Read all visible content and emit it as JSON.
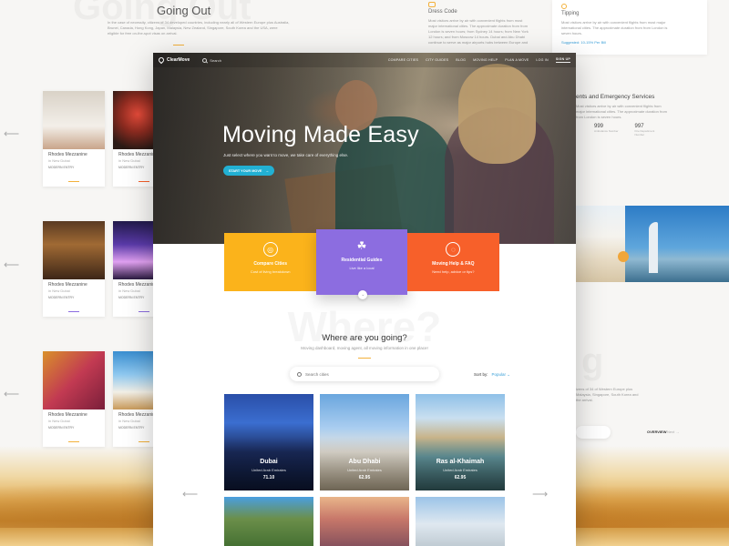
{
  "background": {
    "ghost_top": "Going Out",
    "header_title": "Going Out",
    "header_text": "In the case of necessity, citizens of 34 developed countries, including nearly all of Western Europe plus Australia, Brunei, Canada, Hong Kong, Japan, Malaysia, New Zealand, Singapore, South Korea and the USA, were eligible for free on-the-spot visas on arrival.",
    "dress_code": {
      "title": "Dress Code",
      "text": "Most visitors arrive by air with convenient flights from most major international cities. The approximate duration from from London is seven hours; from Sydney 14 hours; from New York 12 hours; and from Moscow 14 hours. Dubai and Abu Dhabi continue to serve as major airports hubs between Europe and"
    },
    "tipping": {
      "title": "Tipping",
      "text": "Most visitors arrive by air with convenient flights from most major international cities. The approximate duration from from London is seven hours.",
      "link": "Suggested: 10-15% Per Bill"
    },
    "emergency": {
      "title": "ents and Emergency Services",
      "text": "Most visitors arrive by air with convenient flights from major international cities. The approximate duration from from London is seven hours.",
      "stats": [
        {
          "value": "999",
          "label": "Ambulance Number"
        },
        {
          "value": "997",
          "label": "Fire Department Number"
        }
      ]
    },
    "right_text": "izens of 34 of Western Europe plus Malaysia, Singapore, South Korea and the arrival.",
    "overview_label": "OVERVIEW",
    "next_label": "Next",
    "ghost_right": "g",
    "mini_cards": [
      {
        "title": "Rhodes Mezzanine",
        "sub": "in New Dubai",
        "badge": "MODERN ENTRY"
      },
      {
        "title": "Rhodes Mezzanine",
        "sub": "in New Dubai",
        "badge": "MODERN ENTRY"
      },
      {
        "title": "Rhodes Mezzanine",
        "sub": "in New Dubai",
        "badge": "MODERN ENTRY"
      },
      {
        "title": "Rhodes Mezzanine",
        "sub": "in New Dubai",
        "badge": "MODERN ENTRY"
      },
      {
        "title": "Rhodes Mezzanine",
        "sub": "in New Dubai",
        "badge": "MODERN ENTRY"
      },
      {
        "title": "Rhodes Mezzanine",
        "sub": "in New Dubai",
        "badge": "MODERN ENTRY"
      }
    ]
  },
  "nav": {
    "brand": "ClearMove",
    "search_label": "Search",
    "links": [
      "Compare Cities",
      "City Guides",
      "Blog",
      "Moving Help",
      "Plan a Move",
      "Log In",
      "Sign Up"
    ]
  },
  "hero": {
    "title": "Moving Made Easy",
    "subtitle": "Just select where you want to move, we take care of everything else.",
    "cta": "Start Your Move"
  },
  "features": [
    {
      "title": "Compare Cities",
      "sub": "Cost of living breakdown",
      "color": "#fbb31b"
    },
    {
      "title": "Residential Guides",
      "sub": "Live like a local",
      "color": "#8c6de0"
    },
    {
      "title": "Moving Help & FAQ",
      "sub": "Need help, advice or tips?",
      "color": "#f7602a"
    }
  ],
  "where": {
    "ghost": "Where?",
    "title": "Where are you going?",
    "subtitle": "Moving dashboard, moving agent, all moving information in one place!",
    "search_placeholder": "Search cities",
    "sort_label": "Sort by:",
    "sort_value": "Popular"
  },
  "cities": [
    {
      "name": "Dubai",
      "country": "United Arab Emirates",
      "score": "71.10"
    },
    {
      "name": "Abu Dhabi",
      "country": "United Arab Emirates",
      "score": "62.95"
    },
    {
      "name": "Ras al-Khaimah",
      "country": "United Arab Emirates",
      "score": "62.95"
    }
  ]
}
